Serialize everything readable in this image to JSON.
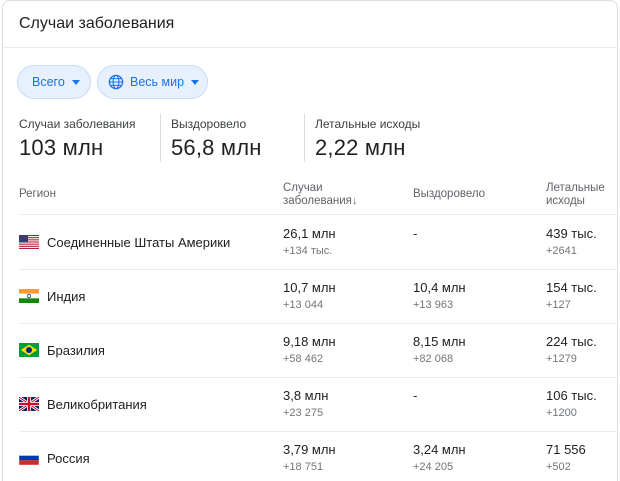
{
  "title": "Случаи заболевания",
  "filters": {
    "total_label": "Всего",
    "region_label": "Весь мир"
  },
  "stats": [
    {
      "label": "Случаи заболевания",
      "value": "103 млн"
    },
    {
      "label": "Выздоровело",
      "value": "56,8 млн"
    },
    {
      "label": "Летальные исходы",
      "value": "2,22 млн"
    }
  ],
  "table": {
    "headers": {
      "region": "Регион",
      "cases_line1": "Случаи",
      "cases_line2": "заболевания",
      "sort_icon": "↓",
      "recovered": "Выздоровело",
      "deaths_line1": "Летальные",
      "deaths_line2": "исходы"
    },
    "rows": [
      {
        "flag": "us-flag-icon",
        "country": "Соединенные Штаты Америки",
        "cases": "26,1 млн",
        "cases_new": "+134 тыс.",
        "recovered": "-",
        "recovered_new": "",
        "deaths": "439 тыс.",
        "deaths_new": "+2641"
      },
      {
        "flag": "india-flag-icon",
        "country": "Индия",
        "cases": "10,7 млн",
        "cases_new": "+13 044",
        "recovered": "10,4 млн",
        "recovered_new": "+13 963",
        "deaths": "154 тыс.",
        "deaths_new": "+127"
      },
      {
        "flag": "brazil-flag-icon",
        "country": "Бразилия",
        "cases": "9,18 млн",
        "cases_new": "+58 462",
        "recovered": "8,15 млн",
        "recovered_new": "+82 068",
        "deaths": "224 тыс.",
        "deaths_new": "+1279"
      },
      {
        "flag": "uk-flag-icon",
        "country": "Великобритания",
        "cases": "3,8 млн",
        "cases_new": "+23 275",
        "recovered": "-",
        "recovered_new": "",
        "deaths": "106 тыс.",
        "deaths_new": "+1200"
      },
      {
        "flag": "russia-flag-icon",
        "country": "Россия",
        "cases": "3,79 млн",
        "cases_new": "+18 751",
        "recovered": "3,24 млн",
        "recovered_new": "+24 205",
        "deaths": "71 556",
        "deaths_new": "+502"
      }
    ]
  },
  "colors": {
    "accent": "#1a73e8",
    "chip_bg": "#e8f0fe"
  }
}
